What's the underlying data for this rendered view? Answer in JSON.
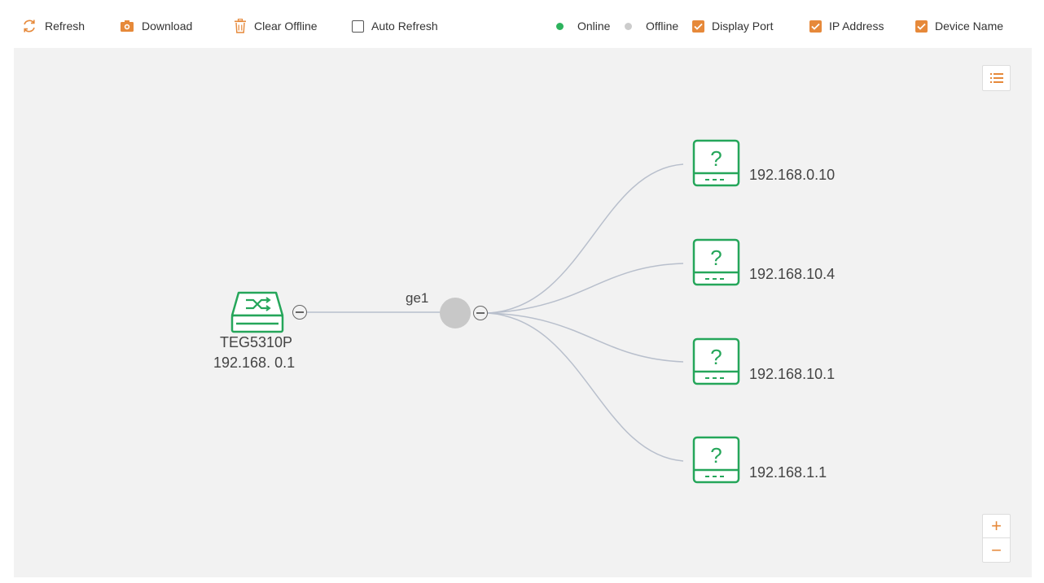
{
  "toolbar": {
    "refresh_label": "Refresh",
    "download_label": "Download",
    "clear_offline_label": "Clear Offline",
    "auto_refresh_label": "Auto Refresh",
    "auto_refresh_checked": false,
    "legend_online": "Online",
    "legend_offline": "Offline",
    "display_port_label": "Display Port",
    "display_port_checked": true,
    "ip_address_label": "IP Address",
    "ip_address_checked": true,
    "device_name_label": "Device Name",
    "device_name_checked": true
  },
  "colors": {
    "accent": "#e6893a",
    "online": "#2db35d",
    "offline": "#cccccc",
    "device_green": "#25a65a",
    "link": "#b8bfcc",
    "port_node": "#c8c8c8"
  },
  "topology": {
    "root": {
      "name": "TEG5310P",
      "ip": "192.168. 0.1",
      "icon": "switch-icon"
    },
    "port": {
      "name": "ge1"
    },
    "clients": [
      {
        "ip": "192.168.0.10",
        "icon": "unknown-device-icon"
      },
      {
        "ip": "192.168.10.4",
        "icon": "unknown-device-icon"
      },
      {
        "ip": "192.168.10.1",
        "icon": "unknown-device-icon"
      },
      {
        "ip": "192.168.1.1",
        "icon": "unknown-device-icon"
      }
    ]
  },
  "controls": {
    "zoom_in": "+",
    "zoom_out": "−"
  }
}
